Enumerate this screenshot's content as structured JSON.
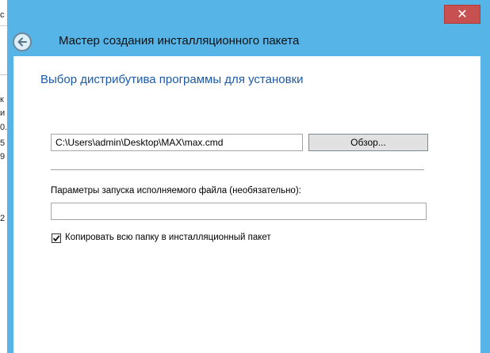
{
  "background_window": {
    "fragments": [
      "c",
      "к",
      "и",
      "0.",
      "5",
      "9",
      "2"
    ]
  },
  "window": {
    "title": "Мастер создания инсталляционного пакета",
    "close_glyph": "✕",
    "accent_color": "#57b4e6"
  },
  "page": {
    "heading": "Выбор дистрибутива программы для установки"
  },
  "form": {
    "path_value": "C:\\Users\\admin\\Desktop\\MAX\\max.cmd",
    "browse_label": "Обзор...",
    "params_label": "Параметры запуска исполняемого файла (необязательно):",
    "params_value": "",
    "copy_folder_label": "Копировать всю папку в инсталляционный пакет",
    "copy_folder_checked": true
  }
}
